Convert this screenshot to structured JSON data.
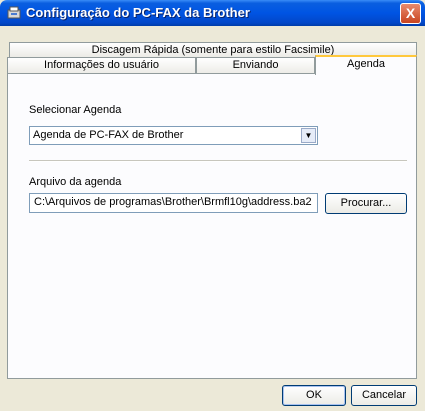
{
  "window": {
    "title": "Configuração do PC-FAX da Brother",
    "close_label": "X"
  },
  "tabs": {
    "top_row": [
      "Discagem Rápida (somente para estilo Facsimile)"
    ],
    "bottom_row": [
      "Informações do usuário",
      "Enviando",
      "Agenda"
    ],
    "active": "Agenda"
  },
  "agenda": {
    "select_label": "Selecionar Agenda",
    "select_value": "Agenda de PC-FAX de Brother",
    "file_label": "Arquivo da agenda",
    "file_path": "C:\\Arquivos de programas\\Brother\\Brmfl10g\\address.ba2",
    "browse_label": "Procurar..."
  },
  "footer": {
    "ok_label": "OK",
    "cancel_label": "Cancelar"
  },
  "icons": {
    "app": "pc-fax-icon",
    "close": "close-icon",
    "dropdown": "chevron-down-icon"
  }
}
